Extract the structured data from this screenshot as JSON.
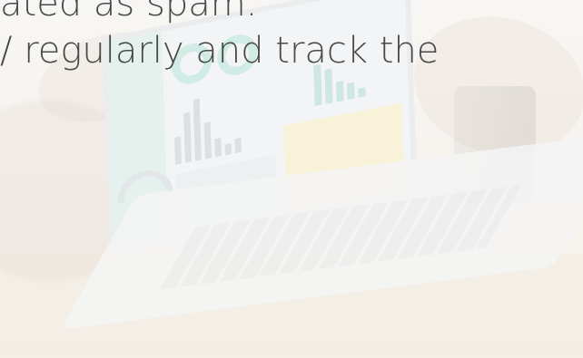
{
  "caption": {
    "line1": "ated as spam.",
    "line2": "/ regularly and track the"
  },
  "laptop_screen_icon": "dashboard-screen",
  "colors": {
    "text": "#4a4a4a",
    "accent_teal": "#a9dccf",
    "accent_yellow": "#f1e7b8",
    "background": "#f4f1ec"
  }
}
